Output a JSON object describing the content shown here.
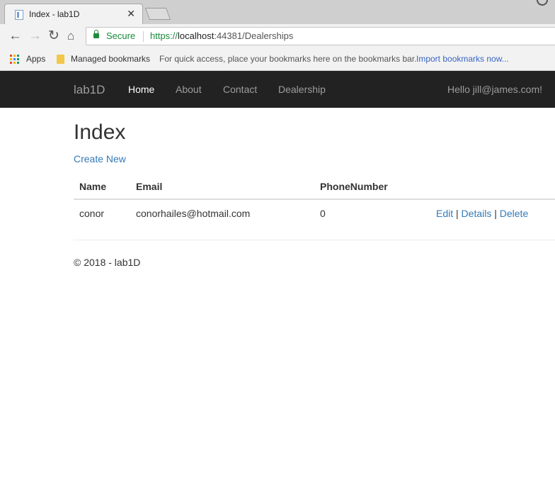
{
  "browser": {
    "tab_title": "Index - lab1D",
    "tab_close": "✕",
    "secure_label": "Secure",
    "url_scheme": "https://",
    "url_host": "localhost",
    "url_rest": ":44381/Dealerships",
    "bookmarks": {
      "apps_label": "Apps",
      "managed_label": "Managed bookmarks",
      "quick_access_text": "For quick access, place your bookmarks here on the bookmarks bar.",
      "import_link": "Import bookmarks now..."
    }
  },
  "navbar": {
    "brand": "lab1D",
    "links": [
      "Home",
      "About",
      "Contact",
      "Dealership"
    ],
    "active": "Home",
    "greeting": "Hello jill@james.com!"
  },
  "main": {
    "title": "Index",
    "create_link": "Create New",
    "table": {
      "headers": [
        "Name",
        "Email",
        "PhoneNumber"
      ],
      "rows": [
        {
          "name": "conor",
          "email": "conorhailes@hotmail.com",
          "phone": "0",
          "actions": [
            "Edit",
            "Details",
            "Delete"
          ]
        }
      ]
    }
  },
  "footer": {
    "text": "© 2018 - lab1D"
  }
}
